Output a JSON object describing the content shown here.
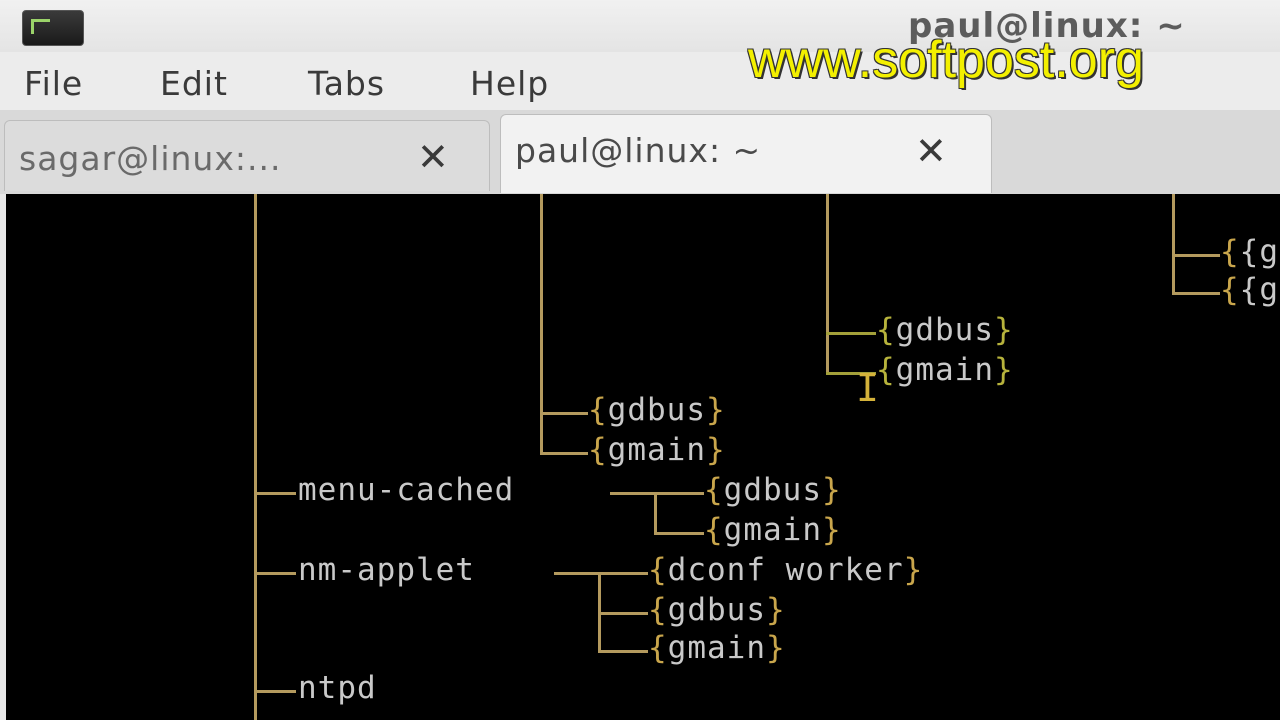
{
  "window": {
    "title": "paul@linux: ~"
  },
  "watermark": "www.softpost.org",
  "menu": {
    "file": "File",
    "edit": "Edit",
    "tabs": "Tabs",
    "help": "Help"
  },
  "tabs": [
    {
      "label": "sagar@linux:...",
      "close": "✕"
    },
    {
      "label": "paul@linux: ~",
      "close": "✕"
    }
  ],
  "tree": {
    "top_right_1": "{g",
    "top_right_2": "{g",
    "gdbus_1": "gdbus",
    "gmain_1": "gmain",
    "gdbus_2": "gdbus",
    "gmain_2": "gmain",
    "menu_cached": "menu-cached",
    "menu_cached_gdbus": "gdbus",
    "menu_cached_gmain": "gmain",
    "nm_applet": "nm-applet",
    "nm_dconf": "dconf worker",
    "nm_gdbus": "gdbus",
    "nm_gmain": "gmain",
    "ntpd": "ntpd"
  }
}
